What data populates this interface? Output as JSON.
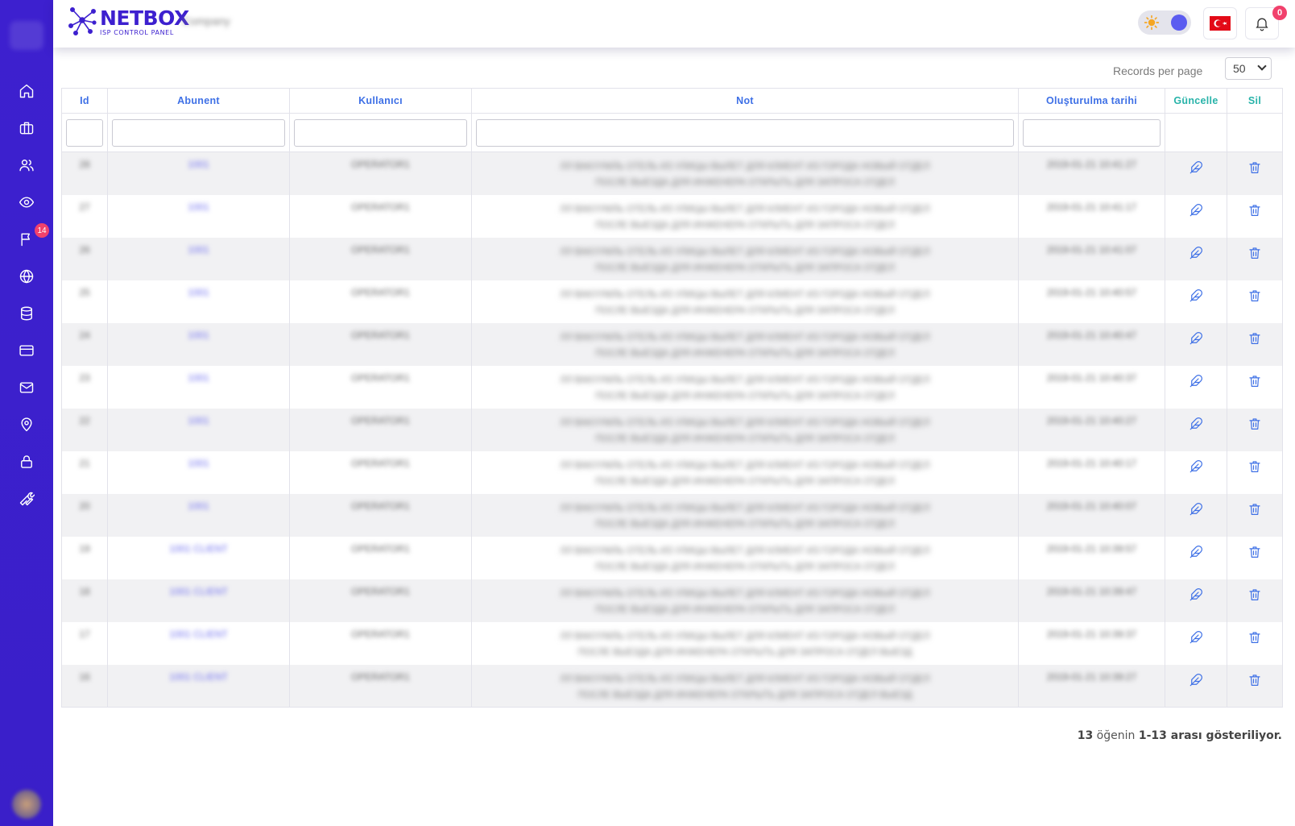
{
  "brand": {
    "title": "NETBOX",
    "subtitle": "ISP CONTROL PANEL",
    "company": "Company"
  },
  "colors": {
    "sidebar": "#3d20cf",
    "accent": "#3e70e6",
    "green_header": "#28b3a9",
    "badge": "#f1416c"
  },
  "sidebar": {
    "items": [
      {
        "icon": "home-icon"
      },
      {
        "icon": "briefcase-icon"
      },
      {
        "icon": "users-icon"
      },
      {
        "icon": "eye-icon"
      },
      {
        "icon": "flag-icon",
        "badge": "14"
      },
      {
        "icon": "globe-icon"
      },
      {
        "icon": "database-icon"
      },
      {
        "icon": "credit-card-icon"
      },
      {
        "icon": "mail-icon"
      },
      {
        "icon": "map-pin-icon"
      },
      {
        "icon": "lock-icon"
      },
      {
        "icon": "wrench-icon"
      }
    ]
  },
  "header": {
    "notification_count": "0",
    "language_flag": "turkey-flag-icon",
    "theme_icon": "sun-icon"
  },
  "pagination": {
    "records_per_page_label": "Records per page",
    "records_per_page_value": "50"
  },
  "table": {
    "columns": [
      "Id",
      "Abunent",
      "Kullanıcı",
      "Not",
      "Oluşturulma tarihi",
      "Güncelle",
      "Sil"
    ],
    "rows": [
      {
        "id": "28",
        "abunent": "1001",
        "user": "OPERATOR1",
        "note1": "ЛЛ ВАКУУМЛЬ ОТЕЛЬ ИЗ УЛИЦЫ ВЫЛЕТ ДЛЯ КЛИЕНТ ИЗ ГОРОДА НОВЫЙ ОТДЕЛ",
        "note2": "ПОСЛЕ ВЫЕЗДА ДЛЯ ИНЖЕНЕРА ОТКРЫТЬ ДЛЯ ЗАПРОСА ОТДЕЛ",
        "date": "2019-01-21 10:41:27"
      },
      {
        "id": "27",
        "abunent": "1001",
        "user": "OPERATOR1",
        "note1": "ЛЛ ВАКУУМЛЬ ОТЕЛЬ ИЗ УЛИЦЫ ВЫЛЕТ ДЛЯ КЛИЕНТ ИЗ ГОРОДА НОВЫЙ ОТДЕЛ",
        "note2": "ПОСЛЕ ВЫЕЗДА ДЛЯ ИНЖЕНЕРА ОТКРЫТЬ ДЛЯ ЗАПРОСА ОТДЕЛ",
        "date": "2019-01-21 10:41:17"
      },
      {
        "id": "26",
        "abunent": "1001",
        "user": "OPERATOR1",
        "note1": "ЛЛ ВАКУУМЛЬ ОТЕЛЬ ИЗ УЛИЦЫ ВЫЛЕТ ДЛЯ КЛИЕНТ ИЗ ГОРОДА НОВЫЙ ОТДЕЛ",
        "note2": "ПОСЛЕ ВЫЕЗДА ДЛЯ ИНЖЕНЕРА ОТКРЫТЬ ДЛЯ ЗАПРОСА ОТДЕЛ",
        "date": "2019-01-21 10:41:07"
      },
      {
        "id": "25",
        "abunent": "1001",
        "user": "OPERATOR1",
        "note1": "ЛЛ ВАКУУМЛЬ ОТЕЛЬ ИЗ УЛИЦЫ ВЫЛЕТ ДЛЯ КЛИЕНТ ИЗ ГОРОДА НОВЫЙ ОТДЕЛ",
        "note2": "ПОСЛЕ ВЫЕЗДА ДЛЯ ИНЖЕНЕРА ОТКРЫТЬ ДЛЯ ЗАПРОСА ОТДЕЛ",
        "date": "2019-01-21 10:40:57"
      },
      {
        "id": "24",
        "abunent": "1001",
        "user": "OPERATOR1",
        "note1": "ЛЛ ВАКУУМЛЬ ОТЕЛЬ ИЗ УЛИЦЫ ВЫЛЕТ ДЛЯ КЛИЕНТ ИЗ ГОРОДА НОВЫЙ ОТДЕЛ",
        "note2": "ПОСЛЕ ВЫЕЗДА ДЛЯ ИНЖЕНЕРА ОТКРЫТЬ ДЛЯ ЗАПРОСА ОТДЕЛ",
        "date": "2019-01-21 10:40:47"
      },
      {
        "id": "23",
        "abunent": "1001",
        "user": "OPERATOR1",
        "note1": "ЛЛ ВАКУУМЛЬ ОТЕЛЬ ИЗ УЛИЦЫ ВЫЛЕТ ДЛЯ КЛИЕНТ ИЗ ГОРОДА НОВЫЙ ОТДЕЛ",
        "note2": "ПОСЛЕ ВЫЕЗДА ДЛЯ ИНЖЕНЕРА ОТКРЫТЬ ДЛЯ ЗАПРОСА ОТДЕЛ",
        "date": "2019-01-21 10:40:37"
      },
      {
        "id": "22",
        "abunent": "1001",
        "user": "OPERATOR1",
        "note1": "ЛЛ ВАКУУМЛЬ ОТЕЛЬ ИЗ УЛИЦЫ ВЫЛЕТ ДЛЯ КЛИЕНТ ИЗ ГОРОДА НОВЫЙ ОТДЕЛ",
        "note2": "ПОСЛЕ ВЫЕЗДА ДЛЯ ИНЖЕНЕРА ОТКРЫТЬ ДЛЯ ЗАПРОСА ОТДЕЛ",
        "date": "2019-01-21 10:40:27"
      },
      {
        "id": "21",
        "abunent": "1001",
        "user": "OPERATOR1",
        "note1": "ЛЛ ВАКУУМЛЬ ОТЕЛЬ ИЗ УЛИЦЫ ВЫЛЕТ ДЛЯ КЛИЕНТ ИЗ ГОРОДА НОВЫЙ ОТДЕЛ",
        "note2": "ПОСЛЕ ВЫЕЗДА ДЛЯ ИНЖЕНЕРА ОТКРЫТЬ ДЛЯ ЗАПРОСА ОТДЕЛ",
        "date": "2019-01-21 10:40:17"
      },
      {
        "id": "20",
        "abunent": "1001",
        "user": "OPERATOR1",
        "note1": "ЛЛ ВАКУУМЛЬ ОТЕЛЬ ИЗ УЛИЦЫ ВЫЛЕТ ДЛЯ КЛИЕНТ ИЗ ГОРОДА НОВЫЙ ОТДЕЛ",
        "note2": "ПОСЛЕ ВЫЕЗДА ДЛЯ ИНЖЕНЕРА ОТКРЫТЬ ДЛЯ ЗАПРОСА ОТДЕЛ",
        "date": "2019-01-21 10:40:07"
      },
      {
        "id": "19",
        "abunent": "1001 CLIENT",
        "user": "OPERATOR1",
        "note1": "ЛЛ ВАКУУМЛЬ ОТЕЛЬ ИЗ УЛИЦЫ ВЫЛЕТ ДЛЯ КЛИЕНТ ИЗ ГОРОДА НОВЫЙ ОТДЕЛ",
        "note2": "ПОСЛЕ ВЫЕЗДА ДЛЯ ИНЖЕНЕРА ОТКРЫТЬ ДЛЯ ЗАПРОСА ОТДЕЛ",
        "date": "2019-01-21 10:39:57"
      },
      {
        "id": "18",
        "abunent": "1001 CLIENT",
        "user": "OPERATOR1",
        "note1": "ЛЛ ВАКУУМЛЬ ОТЕЛЬ ИЗ УЛИЦЫ ВЫЛЕТ ДЛЯ КЛИЕНТ ИЗ ГОРОДА НОВЫЙ ОТДЕЛ",
        "note2": "ПОСЛЕ ВЫЕЗДА ДЛЯ ИНЖЕНЕРА ОТКРЫТЬ ДЛЯ ЗАПРОСА ОТДЕЛ",
        "date": "2019-01-21 10:39:47"
      },
      {
        "id": "17",
        "abunent": "1001 CLIENT",
        "user": "OPERATOR1",
        "note1": "ЛЛ ВАКУУМЛЬ ОТЕЛЬ ИЗ УЛИЦЫ ВЫЛЕТ ДЛЯ КЛИЕНТ ИЗ ГОРОДА НОВЫЙ ОТДЕЛ",
        "note2": "ПОСЛЕ ВЫЕЗДА ДЛЯ ИНЖЕНЕРА ОТКРЫТЬ ДЛЯ ЗАПРОСА ОТДЕЛ ВЫЕЗД",
        "date": "2019-01-21 10:39:37"
      },
      {
        "id": "16",
        "abunent": "1001 CLIENT",
        "user": "OPERATOR1",
        "note1": "ЛЛ ВАКУУМЛЬ ОТЕЛЬ ИЗ УЛИЦЫ ВЫЛЕТ ДЛЯ КЛИЕНТ ИЗ ГОРОДА НОВЫЙ ОТДЕЛ",
        "note2": "ПОСЛЕ ВЫЕЗДА ДЛЯ ИНЖЕНЕРА ОТКРЫТЬ ДЛЯ ЗАПРОСА ОТДЕЛ ВЫЕЗД",
        "date": "2019-01-21 10:39:27"
      }
    ]
  },
  "footer": {
    "total": "13",
    "middle": " öğenin ",
    "range": "1-13 arası gösteriliyor."
  }
}
